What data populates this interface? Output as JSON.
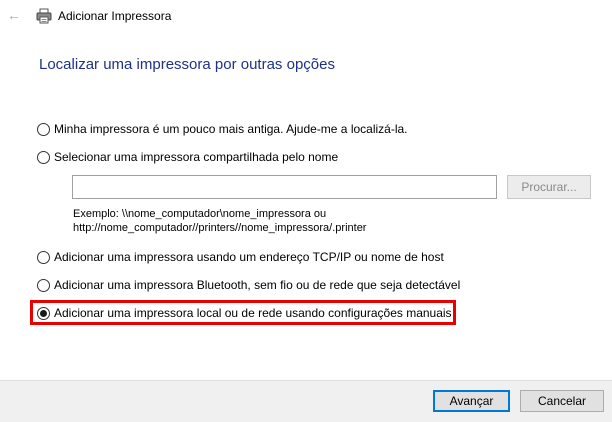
{
  "window": {
    "title": "Adicionar Impressora",
    "back_icon": "←"
  },
  "heading": "Localizar uma impressora por outras opções",
  "options": [
    {
      "label": "Minha impressora é um pouco mais antiga. Ajude-me a localizá-la.",
      "checked": false
    },
    {
      "label": "Selecionar uma impressora compartilhada pelo nome",
      "checked": false
    },
    {
      "label": "Adicionar uma impressora usando um endereço TCP/IP ou nome de host",
      "checked": false
    },
    {
      "label": "Adicionar uma impressora Bluetooth, sem fio ou de rede que seja detectável",
      "checked": false
    },
    {
      "label": "Adicionar uma impressora local ou de rede usando configurações manuais",
      "checked": true
    }
  ],
  "share": {
    "value": "",
    "browse_label": "Procurar...",
    "example_line1": "Exemplo: \\\\nome_computador\\nome_impressora ou",
    "example_line2": "http://nome_computador//printers//nome_impressora/.printer"
  },
  "buttons": {
    "next": "Avançar",
    "cancel": "Cancelar"
  },
  "colors": {
    "heading": "#1e3287",
    "highlight": "#e60000",
    "primary_border": "#0078d7"
  }
}
